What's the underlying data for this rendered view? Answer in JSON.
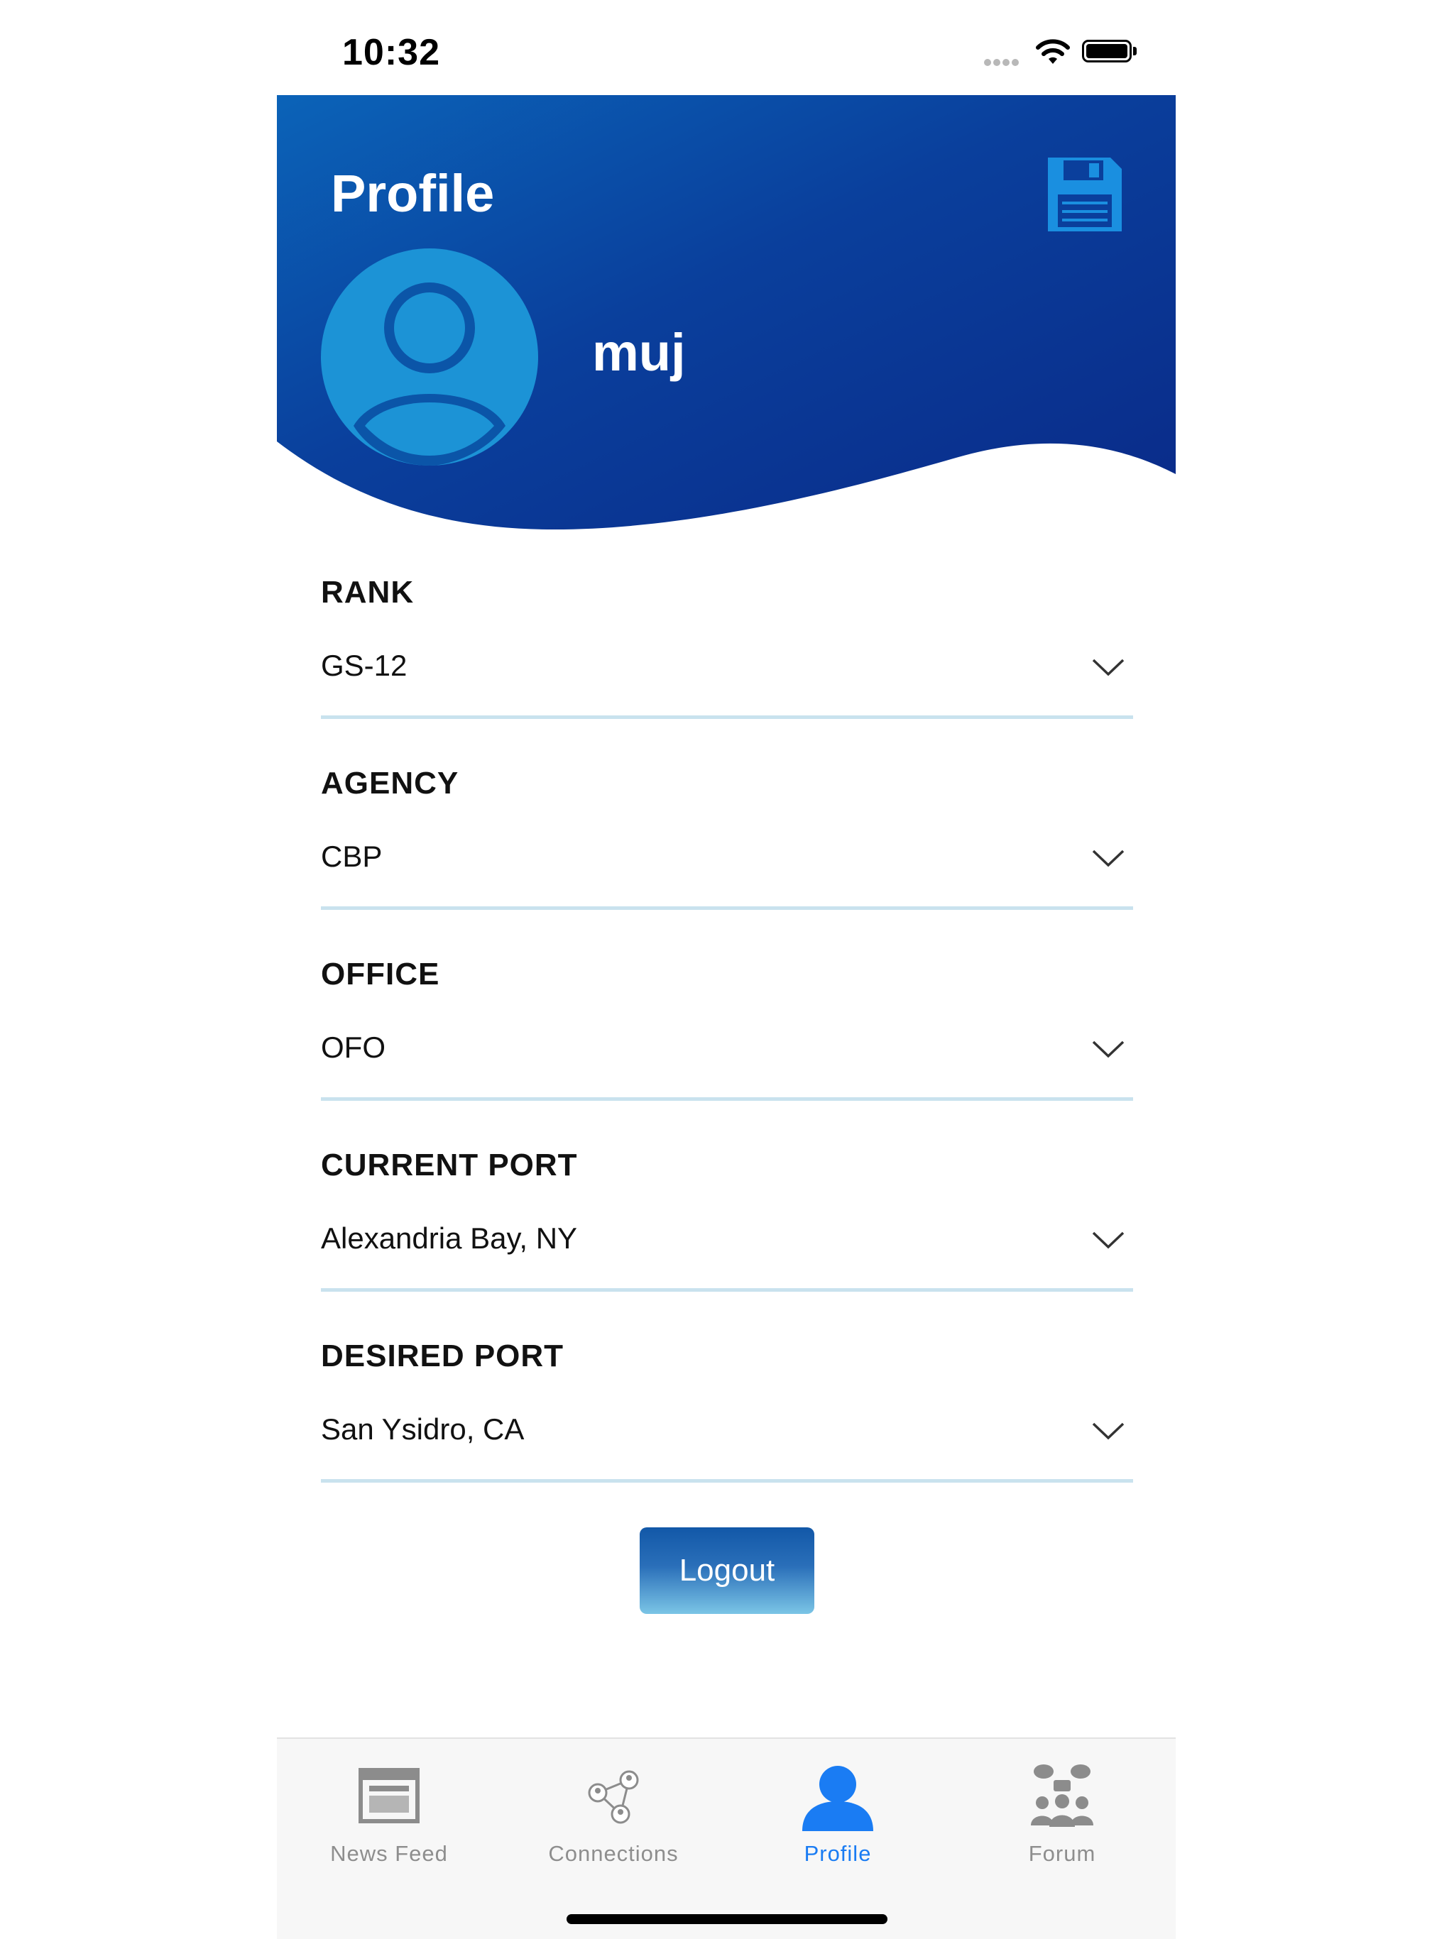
{
  "status_bar": {
    "time": "10:32"
  },
  "header": {
    "title": "Profile",
    "username": "muj",
    "save_icon": "floppy-disk-icon",
    "avatar_icon": "user-avatar-icon"
  },
  "fields": [
    {
      "label": "RANK",
      "value": "GS-12"
    },
    {
      "label": "AGENCY",
      "value": "CBP"
    },
    {
      "label": "OFFICE",
      "value": "OFO"
    },
    {
      "label": "CURRENT PORT",
      "value": "Alexandria Bay, NY"
    },
    {
      "label": "DESIRED PORT",
      "value": "San Ysidro, CA"
    }
  ],
  "logout_label": "Logout",
  "tabs": [
    {
      "label": "News Feed",
      "icon": "news-feed-icon",
      "active": false
    },
    {
      "label": "Connections",
      "icon": "connections-icon",
      "active": false
    },
    {
      "label": "Profile",
      "icon": "profile-icon",
      "active": true
    },
    {
      "label": "Forum",
      "icon": "forum-icon",
      "active": false
    }
  ],
  "colors": {
    "header_start": "#0b5cb5",
    "header_end": "#0a2f8c",
    "accent": "#1a7cf3",
    "field_line": "#c9e2ee"
  }
}
